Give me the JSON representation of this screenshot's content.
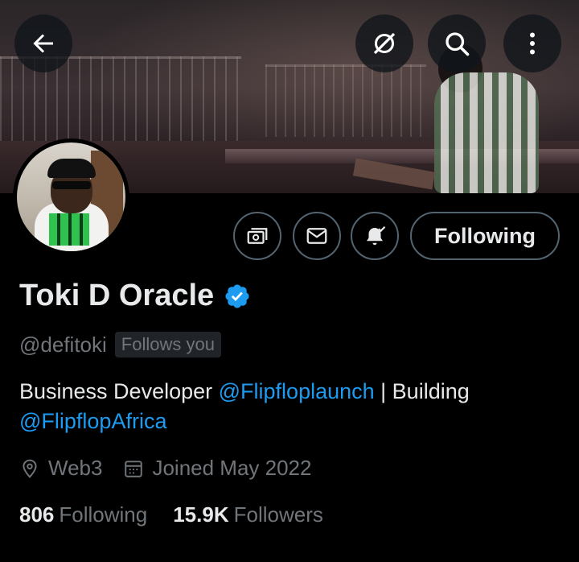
{
  "header": {
    "back_icon": "arrow-left-icon",
    "grok_icon": "grok-icon",
    "search_icon": "search-icon",
    "more_icon": "more-vertical-icon"
  },
  "banner": {
    "description_colors": {
      "accent": "#1d9bf0"
    }
  },
  "actions": {
    "subscribe_icon": "money-icon",
    "message_icon": "envelope-icon",
    "notify_icon": "bell-check-icon",
    "following_label": "Following"
  },
  "profile": {
    "display_name": "Toki D Oracle",
    "verified": true,
    "handle": "@defitoki",
    "follows_you": "Follows you",
    "bio": {
      "part1": "Business Developer ",
      "mention1": "@Flipfloplaunch",
      "part2": " | Building ",
      "mention2": "@FlipflopAfrica"
    },
    "location": "Web3",
    "joined": "Joined May 2022",
    "following_count": "806",
    "following_label": "Following",
    "followers_count": "15.9K",
    "followers_label": "Followers"
  },
  "colors": {
    "background": "#000000",
    "text_primary": "#e7e9ea",
    "text_secondary": "#71767b",
    "link": "#1d9bf0",
    "border": "#536471"
  }
}
